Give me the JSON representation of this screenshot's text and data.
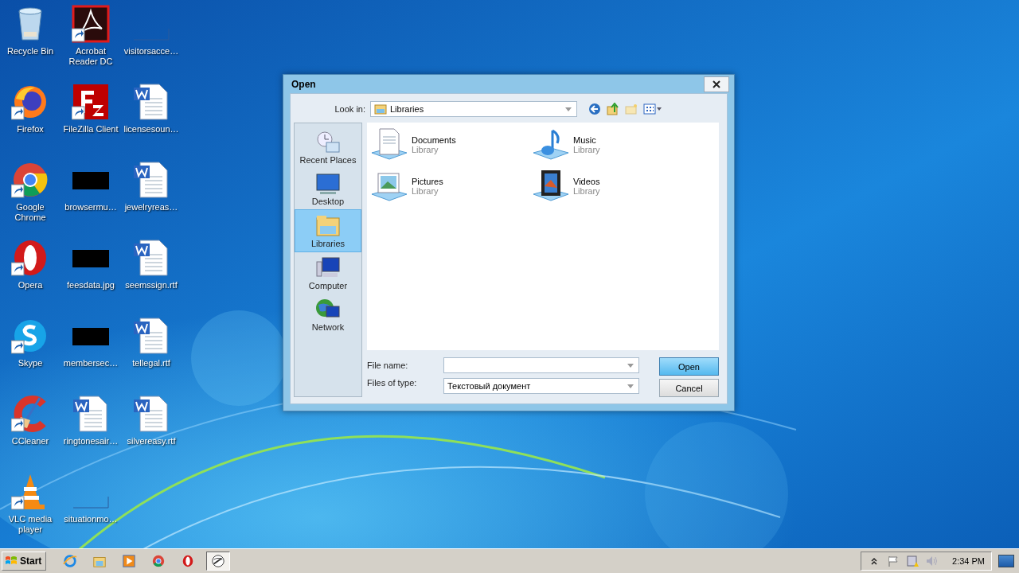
{
  "desktop": {
    "icons": [
      {
        "label": "Recycle Bin",
        "kind": "recycle-bin",
        "shortcut": false
      },
      {
        "label": "Firefox",
        "kind": "firefox",
        "shortcut": true
      },
      {
        "label": "Google Chrome",
        "kind": "chrome",
        "shortcut": true
      },
      {
        "label": "Opera",
        "kind": "opera",
        "shortcut": true
      },
      {
        "label": "Skype",
        "kind": "skype",
        "shortcut": true
      },
      {
        "label": "CCleaner",
        "kind": "ccleaner",
        "shortcut": true
      },
      {
        "label": "VLC media player",
        "kind": "vlc",
        "shortcut": true
      },
      {
        "label": "Acrobat Reader DC",
        "kind": "acrobat",
        "shortcut": true
      },
      {
        "label": "FileZilla Client",
        "kind": "filezilla",
        "shortcut": true
      },
      {
        "label": "browsermu…",
        "kind": "thumbnail",
        "shortcut": false
      },
      {
        "label": "feesdata.jpg",
        "kind": "thumbnail",
        "shortcut": false
      },
      {
        "label": "membersec…",
        "kind": "thumbnail",
        "shortcut": false
      },
      {
        "label": "ringtonesair…",
        "kind": "document",
        "shortcut": false
      },
      {
        "label": "situationmo…",
        "kind": "blank",
        "shortcut": false
      },
      {
        "label": "visitorsacce…",
        "kind": "blank",
        "shortcut": false
      },
      {
        "label": "licensesoun…",
        "kind": "document",
        "shortcut": false
      },
      {
        "label": "jewelryreas…",
        "kind": "document",
        "shortcut": false
      },
      {
        "label": "seemssign.rtf",
        "kind": "document",
        "shortcut": false
      },
      {
        "label": "tellegal.rtf",
        "kind": "document",
        "shortcut": false
      },
      {
        "label": "silvereasy.rtf",
        "kind": "document",
        "shortcut": false
      }
    ]
  },
  "dialog": {
    "title": "Open",
    "look_in": {
      "label": "Look in:",
      "value": "Libraries"
    },
    "places": [
      {
        "label": "Recent Places",
        "kind": "recent",
        "selected": false
      },
      {
        "label": "Desktop",
        "kind": "desktop",
        "selected": false
      },
      {
        "label": "Libraries",
        "kind": "libraries",
        "selected": true
      },
      {
        "label": "Computer",
        "kind": "computer",
        "selected": false
      },
      {
        "label": "Network",
        "kind": "network",
        "selected": false
      }
    ],
    "items": [
      {
        "name": "Documents",
        "type": "Library",
        "kind": "documents"
      },
      {
        "name": "Music",
        "type": "Library",
        "kind": "music"
      },
      {
        "name": "Pictures",
        "type": "Library",
        "kind": "pictures"
      },
      {
        "name": "Videos",
        "type": "Library",
        "kind": "videos"
      }
    ],
    "file_name": {
      "label": "File name:"
    },
    "file_type": {
      "label": "Files of type:",
      "value": "Текстовый документ"
    },
    "buttons": [
      {
        "label": "Open",
        "default": true
      },
      {
        "label": "Cancel",
        "default": false
      }
    ]
  },
  "taskbar": {
    "start": "Start",
    "apps": [
      {
        "kind": "ie",
        "selected": false
      },
      {
        "kind": "explorer",
        "selected": false
      },
      {
        "kind": "player",
        "selected": false
      },
      {
        "kind": "chrome",
        "selected": false
      },
      {
        "kind": "opera",
        "selected": false
      },
      {
        "kind": "pen",
        "selected": true
      }
    ],
    "clock": "2:34 PM"
  }
}
